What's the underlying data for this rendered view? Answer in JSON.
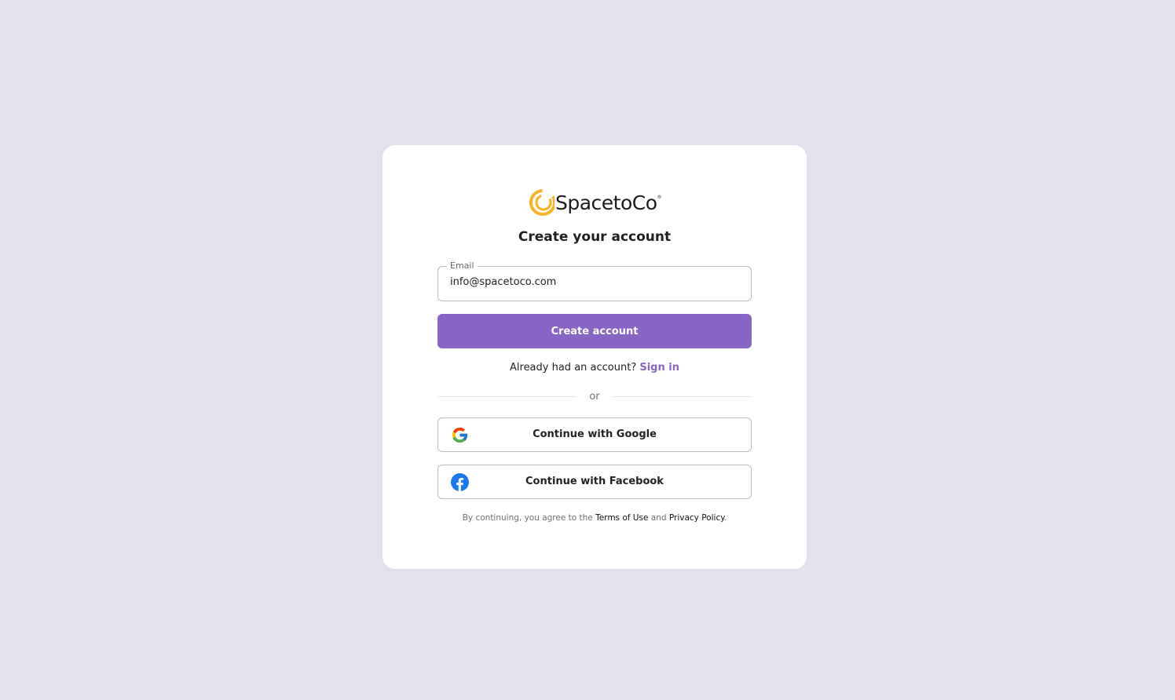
{
  "logo": {
    "name": "SpacetoCo",
    "trademark": "®",
    "brand_color": "#f4b52a"
  },
  "title": "Create your account",
  "email_field": {
    "label": "Email",
    "value": "info@spacetoco.com",
    "placeholder": "Email"
  },
  "primary_button": {
    "label": "Create account",
    "color": "#8864c4"
  },
  "signin": {
    "prompt": "Already had an account? ",
    "link": "Sign in"
  },
  "divider": {
    "label": "or"
  },
  "social": {
    "google": {
      "label": "Continue with Google",
      "icon": "google-icon"
    },
    "facebook": {
      "label": "Continue with Facebook",
      "icon": "facebook-icon",
      "color": "#1877f2"
    }
  },
  "terms": {
    "prefix": "By continuing, you agree to the ",
    "terms_link": "Terms of Use",
    "middle": " and ",
    "privacy_link": "Privacy Policy",
    "suffix": "."
  }
}
